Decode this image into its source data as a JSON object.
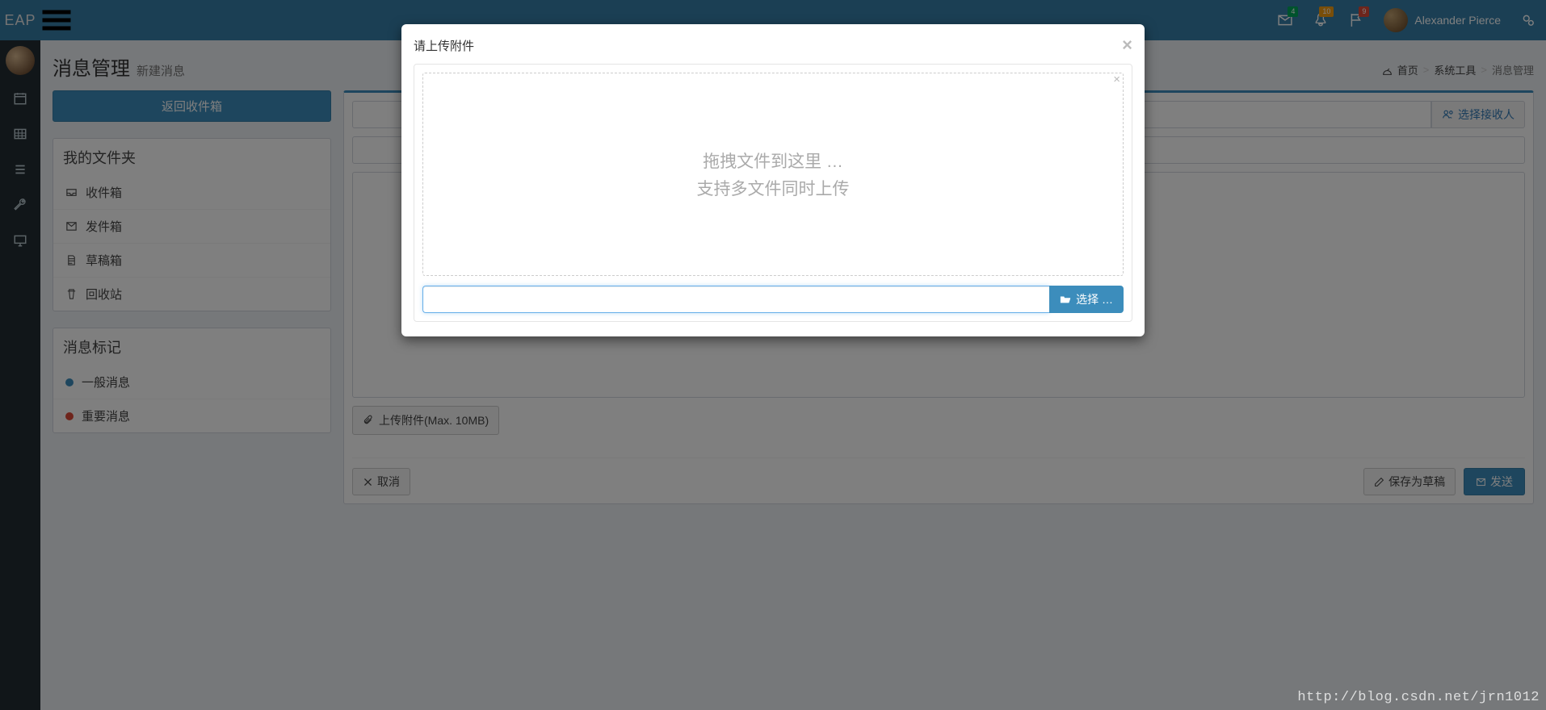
{
  "header": {
    "logo": "EAP",
    "badges": {
      "mail": "4",
      "bell": "10",
      "flag": "9"
    },
    "user_name": "Alexander Pierce"
  },
  "page": {
    "title": "消息管理",
    "subtitle": "新建消息"
  },
  "breadcrumb": {
    "home": "首页",
    "tools": "系统工具",
    "current": "消息管理"
  },
  "left": {
    "back_inbox": "返回收件箱",
    "folders_title": "我的文件夹",
    "folders": {
      "inbox": "收件箱",
      "sent": "发件箱",
      "drafts": "草稿箱",
      "trash": "回收站"
    },
    "tags_title": "消息标记",
    "tags": {
      "normal": "一般消息",
      "important": "重要消息"
    }
  },
  "compose": {
    "select_recipient": "选择接收人",
    "attach_label": "上传附件(Max. 10MB)",
    "cancel": "取消",
    "save_draft": "保存为草稿",
    "send": "发送"
  },
  "modal": {
    "title": "请上传附件",
    "drop_line1": "拖拽文件到这里 …",
    "drop_line2": "支持多文件同时上传",
    "browse": "选择 …"
  },
  "watermark": "http://blog.csdn.net/jrn1012"
}
